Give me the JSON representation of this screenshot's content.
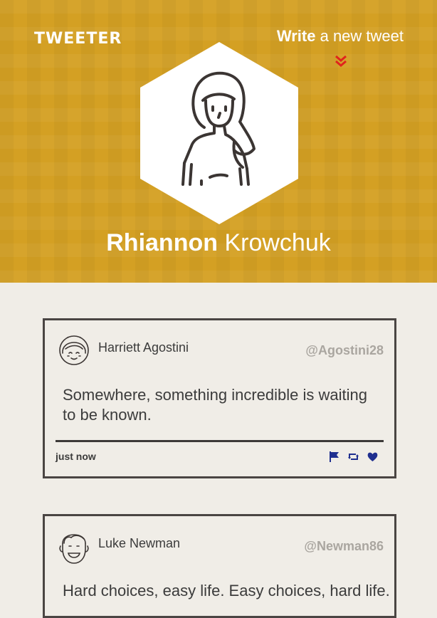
{
  "header": {
    "brand": "TWEETER",
    "write_bold": "Write",
    "write_rest": " a new tweet",
    "profile_first": "Rhiannon",
    "profile_last": " Krowchuk"
  },
  "colors": {
    "header_bg": "#d4a023",
    "page_bg": "#f0ede7",
    "accent_red": "#e0241c",
    "action_blue": "#1f2f8f",
    "handle_gray": "#aaa6a0"
  },
  "tweets": [
    {
      "author": "Harriett Agostini",
      "handle": "@Agostini28",
      "text": "Somewhere, something incredible is waiting to be known.",
      "time": "just now",
      "avatar_icon": "girl-avatar-icon"
    },
    {
      "author": "Luke Newman",
      "handle": "@Newman86",
      "text": "Hard choices, easy life. Easy choices, hard life.",
      "avatar_icon": "man-avatar-icon"
    }
  ],
  "actions": [
    "flag-icon",
    "retweet-icon",
    "heart-icon"
  ]
}
